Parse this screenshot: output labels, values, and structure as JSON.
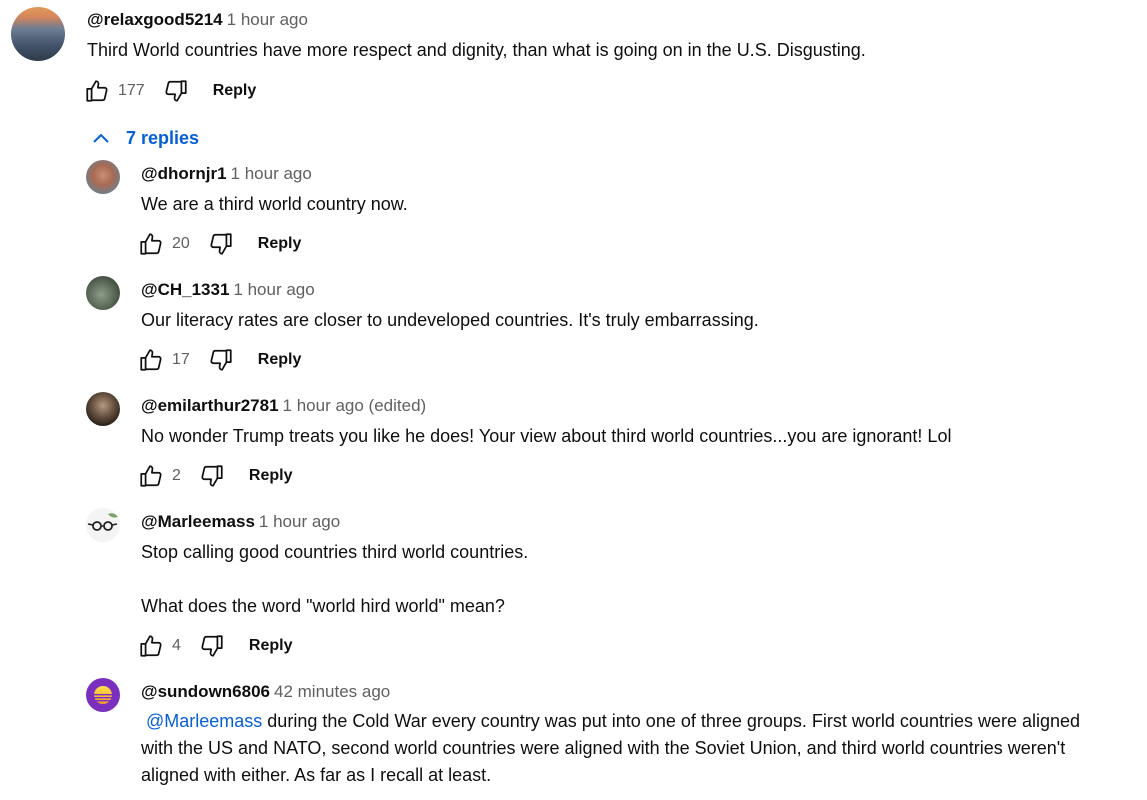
{
  "top_comment": {
    "author": "@relaxgood5214",
    "time": "1 hour ago",
    "text": "Third World countries have more respect and dignity, than what is going on in the U.S.  Disgusting.",
    "likes": "177",
    "reply_label": "Reply"
  },
  "replies_toggle": {
    "label": "7 replies"
  },
  "replies": [
    {
      "author": "@dhornjr1",
      "time": "1 hour ago",
      "text": "We are a third world country now.",
      "likes": "20",
      "reply_label": "Reply"
    },
    {
      "author": "@CH_1331",
      "time": "1 hour ago",
      "text": "Our literacy rates are closer to undeveloped countries. It's truly embarrassing.",
      "likes": "17",
      "reply_label": "Reply"
    },
    {
      "author": "@emilarthur2781",
      "time": "1 hour ago (edited)",
      "text": "No wonder Trump treats you like he does! Your view about third world countries...you are ignorant! Lol",
      "likes": "2",
      "reply_label": "Reply"
    },
    {
      "author": "@Marleemass",
      "time": "1 hour ago",
      "text_line1": "Stop calling good countries third world countries.",
      "text_line2": "What does the  word \"world hird world\" mean?",
      "likes": "4",
      "reply_label": "Reply"
    },
    {
      "author": "@sundown6806",
      "time": "42 minutes ago",
      "mention": "@Marleemass",
      "text_line1": " during the Cold War every country was put into one of three groups. First world countries were aligned",
      "text_line2": "with the US and NATO, second world countries were aligned with the Soviet Union, and third world countries weren't",
      "text_line3": "aligned with either. As far as I recall at least."
    }
  ]
}
